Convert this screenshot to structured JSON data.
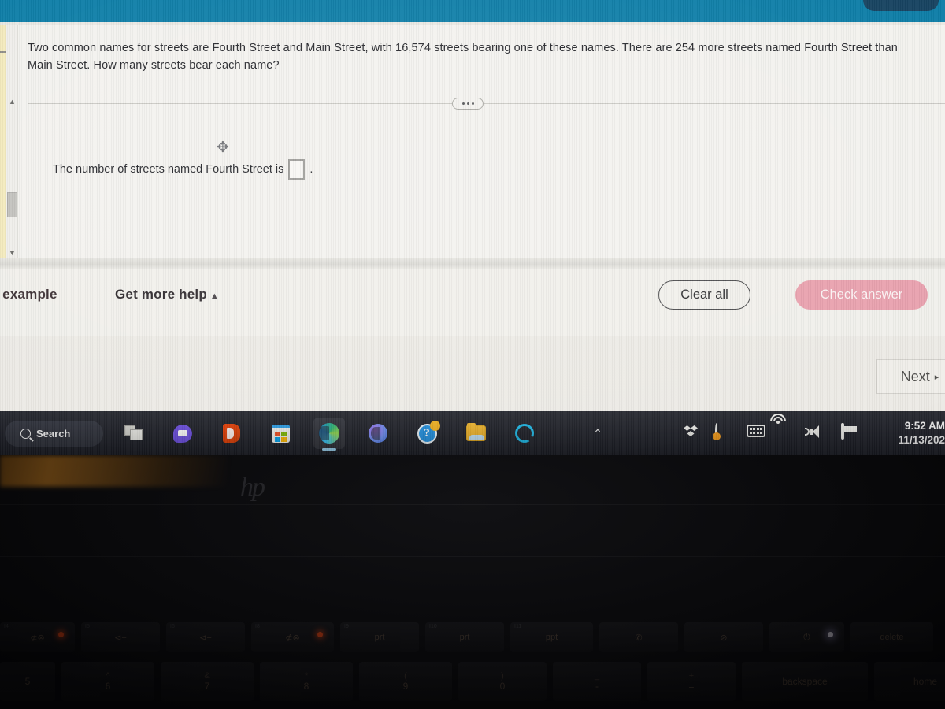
{
  "screen": {
    "header": {
      "pill_label": ""
    },
    "exercise": {
      "question": "Two common names for streets are Fourth Street and Main Street, with 16,574 streets bearing one of these names. There are 254 more streets named Fourth Street than Main Street. How many streets bear each name?",
      "answer_prompt": "The number of streets named Fourth Street is",
      "answer_value": "",
      "answer_period": ".",
      "divider_handle_icon": "drag-handle-dots",
      "move_cursor_icon": "move-4way-icon"
    },
    "actions": {
      "view_example_label": "an example",
      "get_more_help_label": "Get more help",
      "get_more_help_caret": "▲",
      "clear_all_label": "Clear all",
      "check_answer_label": "Check answer",
      "next_label": "Next",
      "next_caret": "▸"
    },
    "scrollbar": {
      "up_arrow": "▲",
      "down_arrow": "▼"
    },
    "colors": {
      "header_teal": "#0b7ca6",
      "header_pill_navy": "#15415f",
      "check_answer_pink": "#e8a0ad",
      "page_background": "#f1f0ec",
      "left_highlight_yellow": "#f5e9b4"
    }
  },
  "taskbar": {
    "search_label": "Search",
    "search_icon": "search-icon",
    "apps": [
      {
        "name": "task-view",
        "icon": "task-view-icon",
        "active": false
      },
      {
        "name": "chat",
        "icon": "chat-icon",
        "active": false
      },
      {
        "name": "office",
        "icon": "office-icon",
        "active": false
      },
      {
        "name": "microsoft-store",
        "icon": "microsoft-store-icon",
        "active": false
      },
      {
        "name": "microsoft-edge",
        "icon": "edge-icon",
        "active": true
      },
      {
        "name": "copilot",
        "icon": "copilot-icon",
        "active": false
      },
      {
        "name": "get-help",
        "icon": "get-help-icon",
        "active": false
      },
      {
        "name": "file-explorer",
        "icon": "file-explorer-icon",
        "active": false
      },
      {
        "name": "alexa",
        "icon": "alexa-icon",
        "active": false
      }
    ],
    "tray": [
      {
        "name": "show-hidden-icons",
        "icon": "chevron-up-icon",
        "glyph": "⌃"
      },
      {
        "name": "onedrive",
        "icon": "onedrive-cloud-icon"
      },
      {
        "name": "onedrive-personal",
        "icon": "cloud-icon"
      },
      {
        "name": "dropbox",
        "icon": "dropbox-icon"
      },
      {
        "name": "sync-status",
        "icon": "sync-icon"
      },
      {
        "name": "touch-keyboard",
        "icon": "keyboard-icon"
      },
      {
        "name": "network",
        "icon": "wifi-icon"
      },
      {
        "name": "volume",
        "icon": "speaker-icon"
      },
      {
        "name": "battery",
        "icon": "battery-icon"
      }
    ],
    "clock": {
      "time": "9:52 AM",
      "date": "11/13/202"
    }
  },
  "laptop": {
    "brand_logo": "hp",
    "function_keys": [
      {
        "label": "⊄⊗",
        "fn": "f4",
        "led": "red"
      },
      {
        "label": "⊲−",
        "fn": "f5",
        "led": ""
      },
      {
        "label": "⊲+",
        "fn": "f6",
        "led": ""
      },
      {
        "label": "⊄⊗",
        "fn": "f8",
        "led": "red"
      },
      {
        "label": "prt",
        "fn": "f9",
        "led": ""
      },
      {
        "label": "prt",
        "fn": "f10",
        "led": ""
      },
      {
        "label": "ppt",
        "fn": "f11",
        "led": ""
      },
      {
        "label": "✆",
        "fn": "",
        "led": ""
      },
      {
        "label": "⊘",
        "fn": "",
        "led": ""
      },
      {
        "label": "⏻",
        "fn": "",
        "led": "white"
      },
      {
        "label": "delete",
        "fn": "",
        "led": ""
      }
    ],
    "number_keys": [
      {
        "top": "",
        "bottom": "5"
      },
      {
        "top": "^",
        "bottom": "6"
      },
      {
        "top": "&",
        "bottom": "7"
      },
      {
        "top": "*",
        "bottom": "8"
      },
      {
        "top": "(",
        "bottom": "9"
      },
      {
        "top": ")",
        "bottom": "0"
      },
      {
        "top": "_",
        "bottom": "-"
      },
      {
        "top": "+",
        "bottom": "="
      },
      {
        "top": "",
        "bottom": "backspace"
      },
      {
        "top": "",
        "bottom": "home"
      }
    ]
  }
}
